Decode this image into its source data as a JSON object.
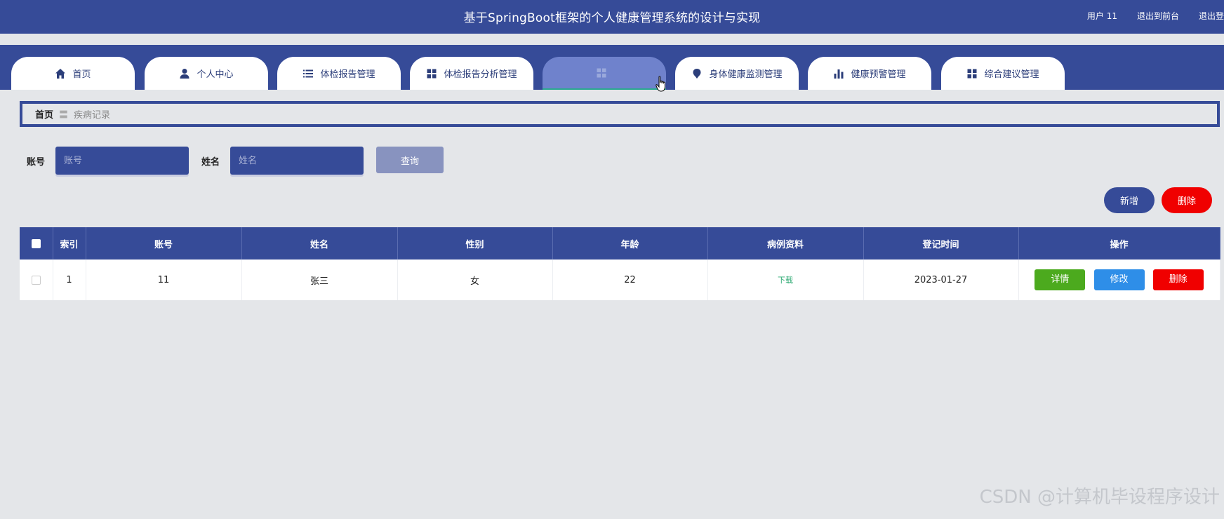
{
  "header": {
    "title": "基于SpringBoot框架的个人健康管理系统的设计与实现",
    "user_label": "用户 11",
    "front_link": "退出到前台",
    "logout_link": "退出登录"
  },
  "nav": {
    "tabs": [
      {
        "label": "首页",
        "icon": "home-icon"
      },
      {
        "label": "个人中心",
        "icon": "user-icon"
      },
      {
        "label": "体检报告管理",
        "icon": "list-icon"
      },
      {
        "label": "体检报告分析管理",
        "icon": "grid-icon"
      },
      {
        "label": "",
        "icon": "grid-icon",
        "active": true
      },
      {
        "label": "身体健康监测管理",
        "icon": "pin-icon"
      },
      {
        "label": "健康预警管理",
        "icon": "bar-chart-icon"
      },
      {
        "label": "综合建议管理",
        "icon": "grid-icon"
      }
    ]
  },
  "breadcrumb": {
    "home": "首页",
    "separator": "〓",
    "current": "疾病记录"
  },
  "search": {
    "account_label": "账号",
    "account_placeholder": "账号",
    "name_label": "姓名",
    "name_placeholder": "姓名",
    "query_button": "查询"
  },
  "actions": {
    "add_button": "新增",
    "delete_button": "删除"
  },
  "table": {
    "columns": [
      "索引",
      "账号",
      "姓名",
      "性别",
      "年龄",
      "病例资料",
      "登记时间",
      "操作"
    ],
    "rows": [
      {
        "index": "1",
        "account": "11",
        "name": "张三",
        "gender": "女",
        "age": "22",
        "file_link": "下载",
        "date": "2023-01-27",
        "detail_button": "详情",
        "edit_button": "修改",
        "delete_button": "删除"
      }
    ]
  },
  "watermark": "CSDN @计算机毕设程序设计",
  "colors": {
    "primary": "#364b98",
    "danger": "#f00000",
    "success": "#4caa1e",
    "info": "#2e8ee8",
    "link": "#2aa870"
  }
}
